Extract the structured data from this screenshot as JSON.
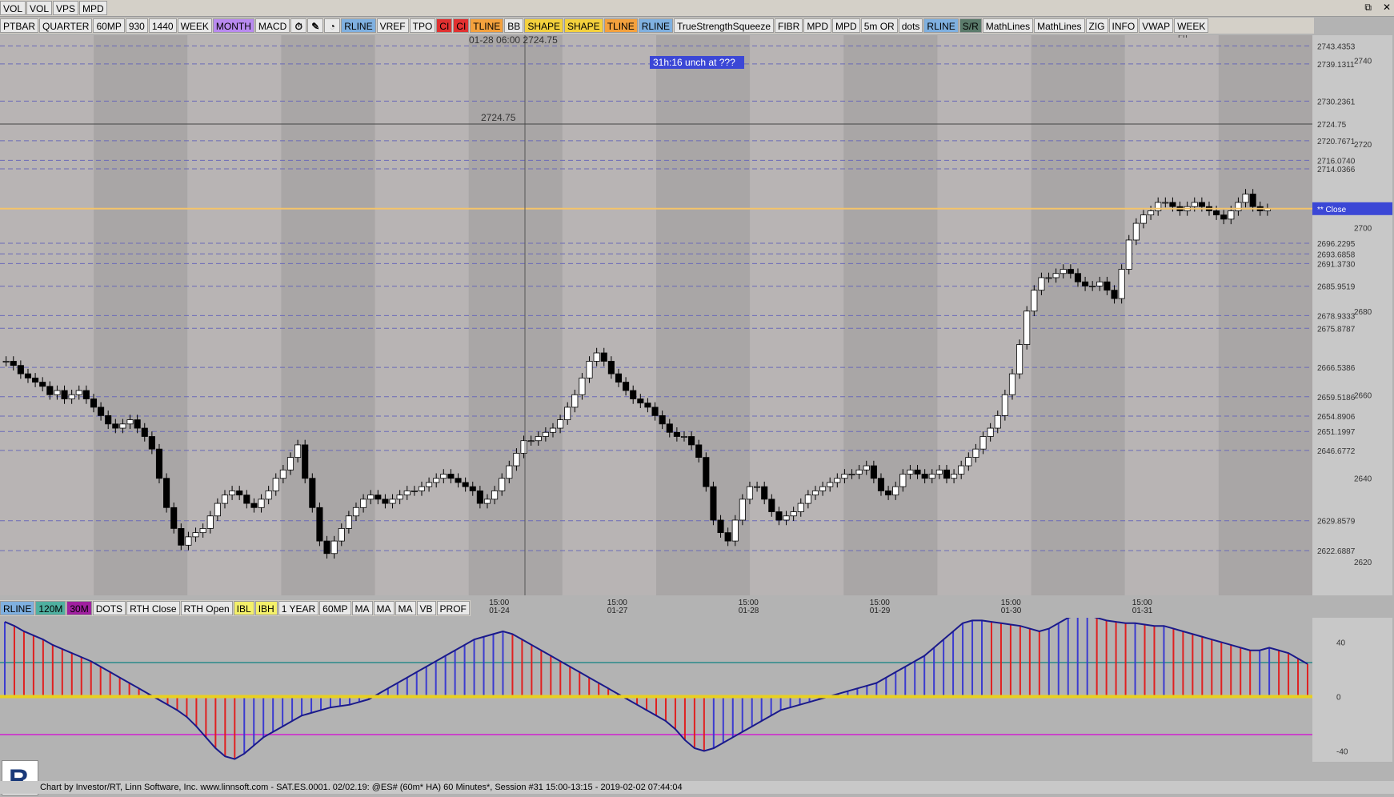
{
  "toolbar_top": [
    "VOL",
    "VOL",
    "VPS",
    "MPD"
  ],
  "toolbar_main": [
    "PTBAR",
    "QUARTER",
    "60MP",
    "930",
    "1440",
    "WEEK",
    "MONTH",
    "MACD",
    "⏱",
    "✎",
    "◔",
    "RLINE",
    "VREF",
    "TPO",
    "CI",
    "CI",
    "TLINE",
    "BB",
    "SHAPE",
    "SHAPE",
    "TLINE",
    "RLINE",
    "TrueStrengthSqueeze",
    "FIBR",
    "MPD",
    "MPD",
    "5m OR",
    "dots",
    "RLINE",
    "S/R",
    "MathLines",
    "MathLines",
    "ZIG",
    "INFO",
    "VWAP",
    "WEEK"
  ],
  "toolbar_bottom": [
    "RLINE",
    "120M",
    "30M",
    "DOTS",
    "RTH Close",
    "RTH Open",
    "IBL",
    "IBH",
    "1 YEAR",
    "60MP",
    "MA",
    "MA",
    "MA",
    "VB",
    "PROF"
  ],
  "window_controls": [
    "⧉",
    "✕"
  ],
  "cursor_label": "01-28 06:00",
  "cursor_price": "2724.75",
  "crosshair_price": "2724.75",
  "timer_label": "31h:16  unch at ???",
  "day_label": "Fri",
  "close_label": "** Close",
  "status_text": "Chart by Investor/RT, Linn Software, Inc. www.linnsoft.com - SAT.ES.0001.   02/02.19: @ES# (60m* HA) 60 Minutes*, Session #31 15:00-13:15 - 2019-02-02 07:44:04",
  "chart_data": {
    "type": "candlestick",
    "symbol": "@ES#",
    "timeframe": "60 Minutes",
    "ylim": [
      2612,
      2746
    ],
    "price_ticks": [
      2620,
      2640,
      2660,
      2680,
      2700,
      2720,
      2740
    ],
    "level_labels": [
      "2743.4353",
      "2739.1311",
      "2730.2361",
      "2724.75",
      "2720.7671",
      "2716.0740",
      "2714.0366",
      "2704.50",
      "2696.2295",
      "2693.6858",
      "2691.3730",
      "2685.9519",
      "2678.9333",
      "2675.8787",
      "2666.5386",
      "2659.5186",
      "2654.8906",
      "2651.1997",
      "2646.6772",
      "2629.8579",
      "2622.6887"
    ],
    "level_values": [
      2743.4353,
      2739.1311,
      2730.2361,
      2724.75,
      2720.7671,
      2716.074,
      2714.0366,
      2704.5,
      2696.2295,
      2693.6858,
      2691.373,
      2685.9519,
      2678.9333,
      2675.8787,
      2666.5386,
      2659.5186,
      2654.8906,
      2651.1997,
      2646.6772,
      2629.8579,
      2622.6887
    ],
    "last_price": 2704.5,
    "x_time_labels": [
      "15:00",
      "15:00",
      "15:00",
      "15:00",
      "15:00",
      "15:00"
    ],
    "x_date_labels": [
      "01-24",
      "01-27",
      "01-28",
      "01-29",
      "01-30",
      "01-31"
    ],
    "x_positions_hint": [
      0.38,
      0.47,
      0.57,
      0.67,
      0.77,
      0.87
    ],
    "close": [
      2668,
      2667,
      2665,
      2664,
      2663,
      2662,
      2660,
      2661,
      2659,
      2660,
      2661,
      2659,
      2657,
      2655,
      2653,
      2652,
      2653,
      2654,
      2652,
      2650,
      2647,
      2640,
      2633,
      2628,
      2624,
      2626,
      2627,
      2628,
      2631,
      2634,
      2636,
      2637,
      2636,
      2634,
      2633,
      2635,
      2637,
      2640,
      2642,
      2645,
      2648,
      2640,
      2633,
      2625,
      2622,
      2625,
      2628,
      2631,
      2633,
      2635,
      2636,
      2635,
      2634,
      2635,
      2636,
      2637,
      2637,
      2638,
      2639,
      2640,
      2641,
      2640,
      2639,
      2638,
      2637,
      2634,
      2635,
      2637,
      2640,
      2643,
      2646,
      2649,
      2649,
      2650,
      2651,
      2652,
      2654,
      2657,
      2660,
      2664,
      2668,
      2670,
      2668,
      2665,
      2663,
      2661,
      2659,
      2658,
      2657,
      2655,
      2653,
      2651,
      2650,
      2650,
      2648,
      2645,
      2638,
      2630,
      2627,
      2625,
      2630,
      2635,
      2638,
      2638,
      2635,
      2632,
      2630,
      2631,
      2632,
      2634,
      2636,
      2637,
      2638,
      2639,
      2640,
      2641,
      2641,
      2642,
      2643,
      2640,
      2637,
      2636,
      2638,
      2641,
      2642,
      2641,
      2640,
      2641,
      2642,
      2640,
      2641,
      2643,
      2645,
      2647,
      2650,
      2652,
      2655,
      2660,
      2665,
      2672,
      2680,
      2685,
      2688,
      2688,
      2689,
      2690,
      2689,
      2687,
      2686,
      2686,
      2687,
      2685,
      2683,
      2690,
      2697,
      2701,
      2703,
      2704,
      2706,
      2706,
      2705,
      2704,
      2705,
      2706,
      2705,
      2704,
      2703,
      2702,
      2704,
      2706,
      2708,
      2705,
      2704,
      2704.5
    ],
    "osc_ylim": [
      -48,
      58
    ],
    "osc_ticks": [
      40,
      0,
      -40
    ],
    "osc_values": [
      55,
      52,
      48,
      45,
      42,
      38,
      35,
      32,
      29,
      26,
      22,
      18,
      14,
      10,
      6,
      2,
      -2,
      -6,
      -10,
      -15,
      -22,
      -30,
      -38,
      -44,
      -46,
      -42,
      -36,
      -30,
      -26,
      -22,
      -18,
      -14,
      -12,
      -10,
      -8,
      -7,
      -6,
      -4,
      -2,
      2,
      6,
      10,
      14,
      18,
      22,
      26,
      30,
      34,
      38,
      42,
      44,
      46,
      48,
      46,
      42,
      38,
      34,
      30,
      26,
      22,
      18,
      14,
      10,
      6,
      2,
      -2,
      -6,
      -10,
      -14,
      -18,
      -24,
      -32,
      -38,
      -40,
      -38,
      -34,
      -30,
      -26,
      -22,
      -18,
      -14,
      -10,
      -8,
      -6,
      -4,
      -2,
      0,
      2,
      4,
      6,
      8,
      10,
      14,
      18,
      22,
      26,
      30,
      36,
      42,
      48,
      54,
      56,
      56,
      55,
      54,
      53,
      52,
      50,
      48,
      50,
      54,
      58,
      60,
      60,
      58,
      56,
      55,
      54,
      54,
      53,
      52,
      52,
      50,
      48,
      46,
      44,
      42,
      40,
      38,
      36,
      34,
      34,
      36,
      34,
      32,
      28,
      24
    ],
    "osc_levels": [
      25,
      -28
    ]
  }
}
